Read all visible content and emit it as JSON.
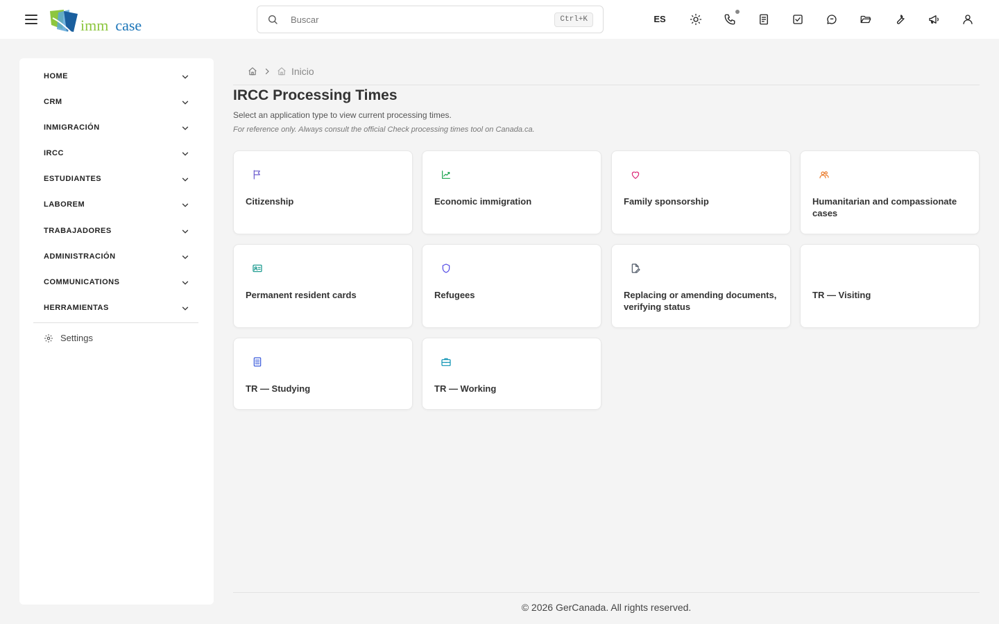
{
  "header": {
    "logo_left": "imm",
    "logo_right": "case",
    "search_placeholder": "Buscar",
    "search_shortcut": "Ctrl+K",
    "language": "ES",
    "icons": [
      "sun-icon",
      "phone-icon",
      "document-icon",
      "checkbox-icon",
      "chat-icon",
      "folder-open-icon",
      "wrench-icon",
      "megaphone-icon",
      "user-icon"
    ]
  },
  "sidebar": {
    "items": [
      {
        "label": "HOME"
      },
      {
        "label": "CRM"
      },
      {
        "label": "INMIGRACIÓN"
      },
      {
        "label": "IRCC"
      },
      {
        "label": "ESTUDIANTES"
      },
      {
        "label": "LABOREM"
      },
      {
        "label": "TRABAJADORES"
      },
      {
        "label": "ADMINISTRACIÓN"
      },
      {
        "label": "COMMUNICATIONS"
      },
      {
        "label": "HERRAMIENTAS"
      }
    ],
    "settings_label": "Settings"
  },
  "breadcrumb": {
    "current": "Inicio"
  },
  "main": {
    "title": "IRCC Processing Times",
    "subtitle": "Select an application type to view current processing times.",
    "note": "For reference only. Always consult the official Check processing times tool on Canada.ca.",
    "cards": [
      {
        "title": "Citizenship",
        "icon": "flag-icon",
        "color": "#6a5acd"
      },
      {
        "title": "Economic immigration",
        "icon": "trending-up-icon",
        "color": "#16a34a"
      },
      {
        "title": "Family sponsorship",
        "icon": "heart-icon",
        "color": "#db2777"
      },
      {
        "title": "Humanitarian and compassionate cases",
        "icon": "users-icon",
        "color": "#ea7a2a"
      },
      {
        "title": "Permanent resident cards",
        "icon": "id-card-icon",
        "color": "#0d9488"
      },
      {
        "title": "Refugees",
        "icon": "shield-icon",
        "color": "#4f46e5"
      },
      {
        "title": "Replacing or amending documents, verifying status",
        "icon": "document-edit-icon",
        "color": "#4b5563"
      },
      {
        "title": "TR — Visiting",
        "icon": "none",
        "color": "#ffffff"
      },
      {
        "title": "TR — Studying",
        "icon": "document-lines-icon",
        "color": "#3b5bdb"
      },
      {
        "title": "TR — Working",
        "icon": "briefcase-icon",
        "color": "#0891b2"
      }
    ]
  },
  "footer": {
    "text": "© 2026 GerCanada. All rights reserved."
  }
}
